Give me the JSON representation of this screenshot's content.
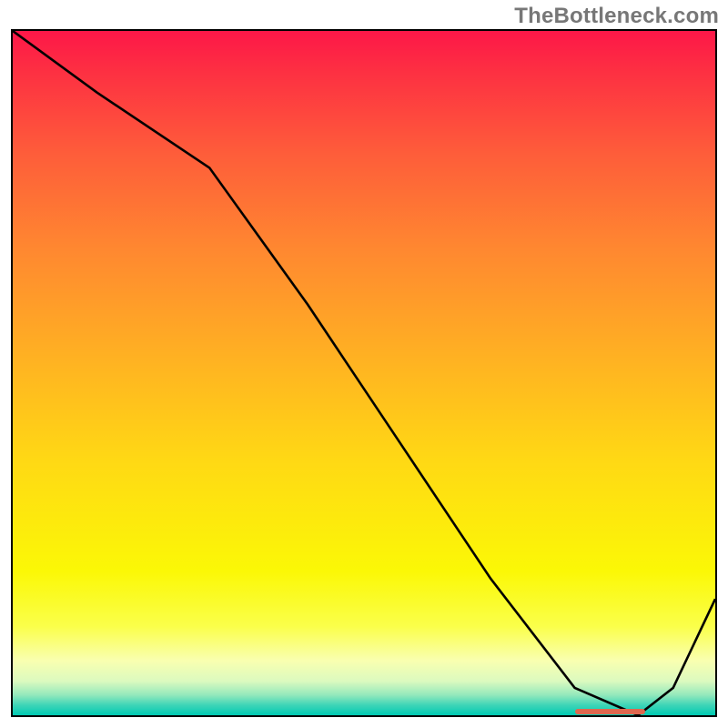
{
  "watermark": "TheBottleneck.com",
  "chart_data": {
    "type": "line",
    "title": "",
    "xlabel": "",
    "ylabel": "",
    "xlim": [
      0,
      100
    ],
    "ylim": [
      0,
      100
    ],
    "x": [
      0,
      12,
      28,
      42,
      55,
      68,
      80,
      89,
      94,
      100
    ],
    "values": [
      100,
      91,
      80,
      60,
      40,
      20,
      4,
      0,
      4,
      17
    ],
    "flat_region": {
      "x_start": 80,
      "x_end": 90,
      "value": 0
    },
    "legend": null,
    "annotations": []
  }
}
